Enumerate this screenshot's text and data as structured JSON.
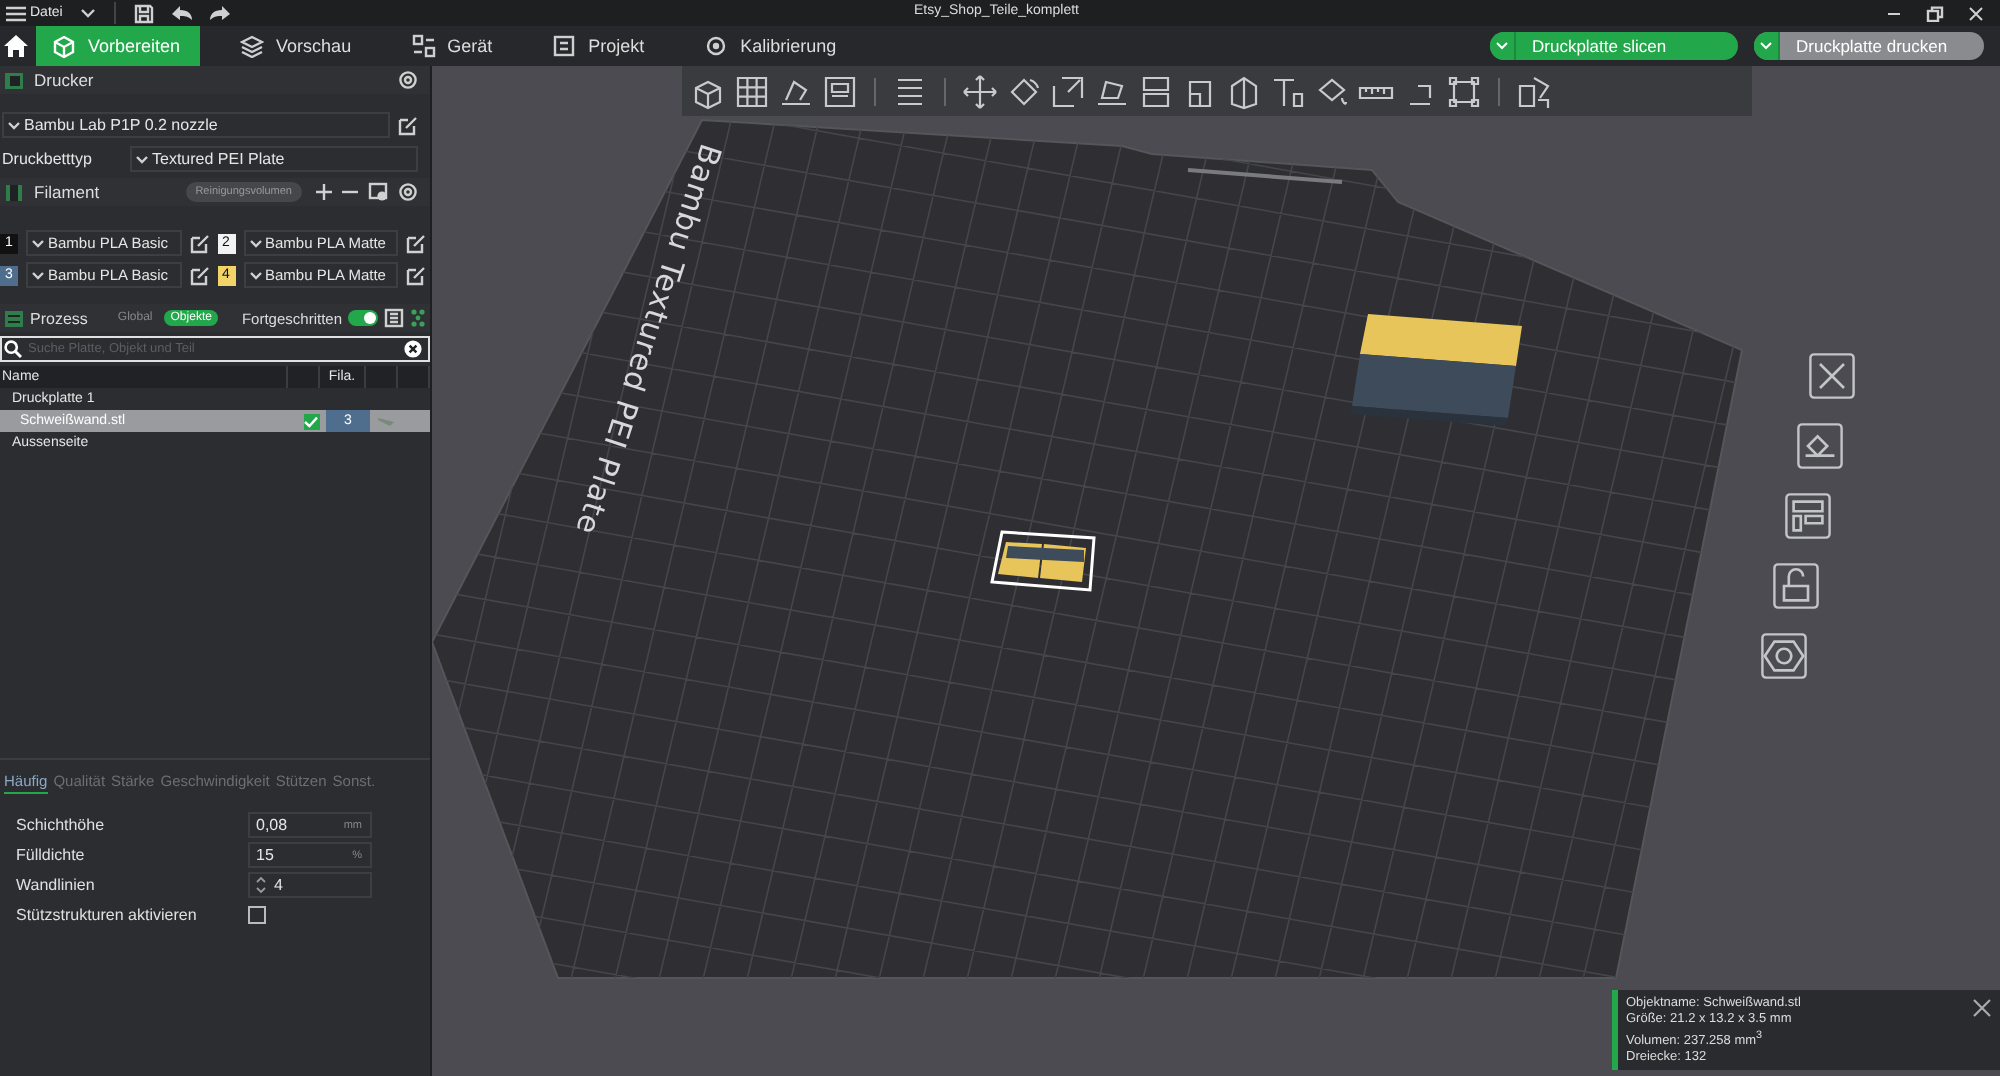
{
  "title_bar": {
    "menu": "Datei",
    "title": "Etsy_Shop_Teile_komplett"
  },
  "tabs": [
    {
      "label": "Vorbereiten",
      "selected": true
    },
    {
      "label": "Vorschau",
      "selected": false
    },
    {
      "label": "Gerät",
      "selected": false
    },
    {
      "label": "Projekt",
      "selected": false
    },
    {
      "label": "Kalibrierung",
      "selected": false
    }
  ],
  "actions": [
    {
      "label": "Druckplatte slicen",
      "kind": "primary"
    },
    {
      "label": "Druckplatte drucken",
      "kind": "secondary"
    }
  ],
  "printer": {
    "heading": "Drucker",
    "model": "Bambu Lab P1P 0.2 nozzle",
    "bed_label": "Druckbetttyp",
    "bed_type": "Textured PEI Plate"
  },
  "filament": {
    "heading": "Filament",
    "purge_button": "Reinigungsvolumen",
    "slots": [
      {
        "number": "1",
        "color": "#111111",
        "name": "Bambu PLA Basic"
      },
      {
        "number": "2",
        "color": "#f2f2f2",
        "name": "Bambu PLA Matte"
      },
      {
        "number": "3",
        "color": "#4f6e8e",
        "name": "Bambu PLA Basic"
      },
      {
        "number": "4",
        "color": "#f1d36a",
        "name": "Bambu PLA Matte"
      }
    ]
  },
  "process": {
    "heading": "Prozess",
    "modes": [
      {
        "label": "Global",
        "selected": false
      },
      {
        "label": "Objekte",
        "selected": true
      }
    ],
    "advanced_label": "Fortgeschritten",
    "advanced": true,
    "search": {
      "placeholder": "Suche Platte, Objekt und Teil"
    }
  },
  "object_table": {
    "columns": [
      "Name",
      "Fila."
    ],
    "rows": [
      {
        "name": "Druckplatte 1",
        "selected": false,
        "children": [
          {
            "name": "Schweißwand.stl",
            "selected": true,
            "checked": true,
            "filament": "3"
          }
        ]
      },
      {
        "name": "Aussenseite",
        "selected": false
      }
    ]
  },
  "settings": {
    "tabs": [
      {
        "label": "Häufig",
        "selected": true
      },
      {
        "label": "Qualität",
        "selected": false
      },
      {
        "label": "Stärke",
        "selected": false
      },
      {
        "label": "Geschwindigkeit",
        "selected": false
      },
      {
        "label": "Stützen",
        "selected": false
      },
      {
        "label": "Sonst.",
        "selected": false
      }
    ],
    "rows": [
      {
        "kind": "field",
        "label": "Schichthöhe",
        "value": "0,08",
        "unit": "mm"
      },
      {
        "kind": "field",
        "label": "Fülldichte",
        "value": "15",
        "unit": "%"
      },
      {
        "kind": "spinner",
        "label": "Wandlinien",
        "value": "4"
      },
      {
        "kind": "checkbox",
        "label": "Stützstrukturen aktivieren",
        "checked": false
      }
    ]
  },
  "viewport": {
    "plate_label": "Bambu Textured PEI Plate"
  },
  "info": {
    "lines": [
      "Objektname: Schweißwand.stl",
      "Größe: 21.2 x 13.2 x 3.5 mm",
      "Volumen: 237.258 mm$^{3}$",
      "Dreiecke: 132"
    ]
  }
}
